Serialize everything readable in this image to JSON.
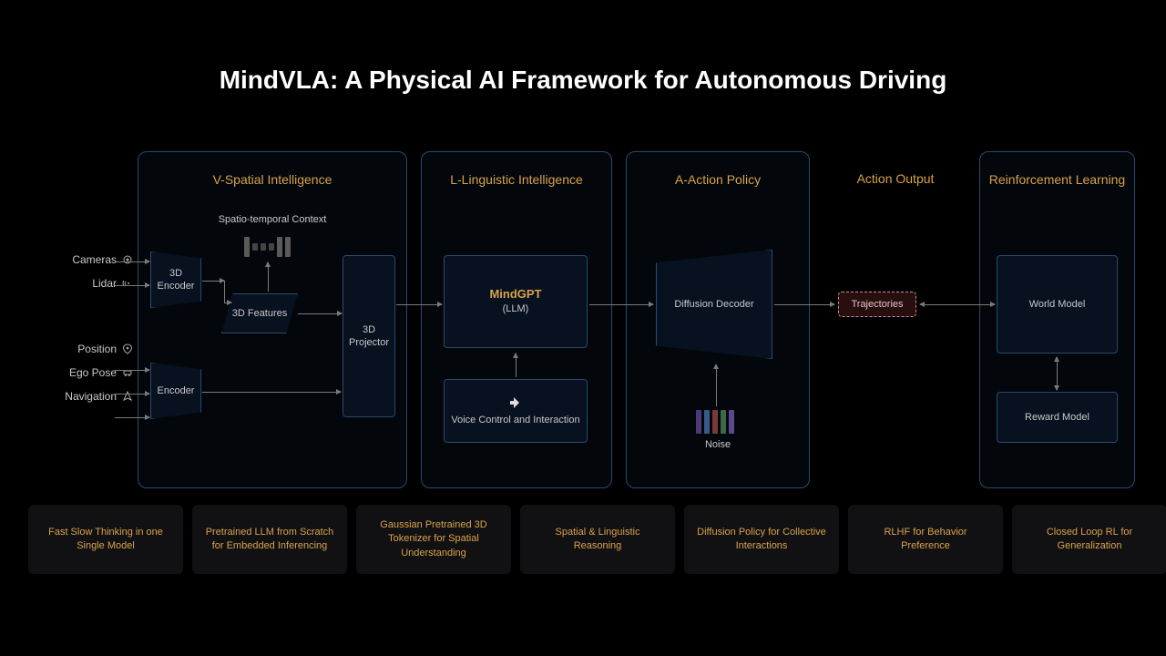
{
  "title": "MindVLA: A Physical AI Framework for Autonomous Driving",
  "inputs": {
    "cameras": "Cameras",
    "lidar": "Lidar",
    "position": "Position",
    "egopose": "Ego Pose",
    "navigation": "Navigation"
  },
  "modules": {
    "vspatial": "V-Spatial Intelligence",
    "linguistic": "L-Linguistic Intelligence",
    "action": "A-Action Policy",
    "output": "Action Output",
    "rl": "Reinforcement Learning"
  },
  "blocks": {
    "encoder3d": "3D Encoder",
    "encoder": "Encoder",
    "features3d": "3D Features",
    "projector3d": "3D Projector",
    "context": "Spatio-temporal Context",
    "mindgpt": "MindGPT",
    "llm": "(LLM)",
    "voice": "Voice Control and Interaction",
    "diffusion": "Diffusion Decoder",
    "noise": "Noise",
    "trajectories": "Trajectories",
    "worldmodel": "World Model",
    "rewardmodel": "Reward Model"
  },
  "features": [
    "Fast Slow Thinking in one Single Model",
    "Pretrained LLM from Scratch for Embedded Inferencing",
    "Gaussian Pretrained 3D Tokenizer for Spatial Understanding",
    "Spatial & Linguistic Reasoning",
    "Diffusion Policy for Collective Interactions",
    "RLHF for Behavior Preference",
    "Closed Loop RL for Generalization"
  ]
}
